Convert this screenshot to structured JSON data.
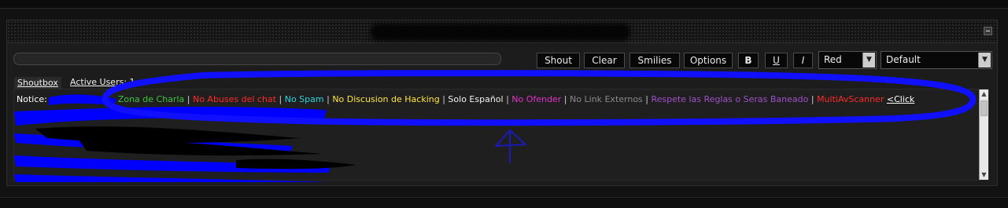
{
  "toolbar": {
    "shout_label": "Shout",
    "clear_label": "Clear",
    "smilies_label": "Smilies",
    "options_label": "Options",
    "bold_label": "B",
    "underline_label": "U",
    "italic_label": "I",
    "color_select": {
      "selected": "Red"
    },
    "font_select": {
      "selected": "Default"
    }
  },
  "tabs": {
    "shoutbox_label": "Shoutbox",
    "active_users_label": "Active Users",
    "active_users_count": ": 1"
  },
  "notice": {
    "label": "Notice:",
    "items": [
      {
        "text": "© - Zona de Charla",
        "color": "#3ec43e"
      },
      {
        "text": "No Abuses del chat",
        "color": "#ff2a2a"
      },
      {
        "text": "No Spam",
        "color": "#2ad6e0"
      },
      {
        "text": "No Discusion de Hacking",
        "color": "#ffe640"
      },
      {
        "text": "Solo Español",
        "color": "#f2f2f2"
      },
      {
        "text": "No Ofender",
        "color": "#e230c8"
      },
      {
        "text": "No Link Externos",
        "color": "#8a8a8a"
      },
      {
        "text": "Respete las Reglas o Seras Baneado",
        "color": "#a050c8"
      },
      {
        "text": "MultiAvScanner",
        "color": "#ff2a2a"
      }
    ],
    "separator": " | ",
    "link_text": "<Click"
  },
  "icons": {
    "collapse": "minus-icon",
    "scroll_up": "chevron-up-icon",
    "scroll_down": "chevron-down-icon",
    "select_arrow": "chevron-down-icon"
  },
  "colors": {
    "annotation_blue": "#1010ff",
    "panel_bg": "#1c1c1c"
  }
}
